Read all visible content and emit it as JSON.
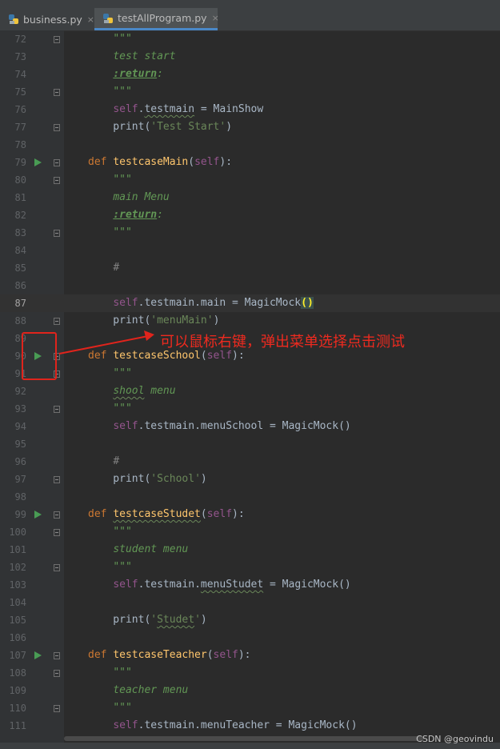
{
  "tabs": [
    {
      "label": "business.py",
      "active": false
    },
    {
      "label": "testAllProgram.py",
      "active": true
    }
  ],
  "tab_close_glyph": "×",
  "lines": [
    {
      "n": "72",
      "html": "    <span class='doc'>\"\"\"</span>"
    },
    {
      "n": "73",
      "html": "    <span class='doc'>test start</span>"
    },
    {
      "n": "74",
      "html": "    <span class='doctag'>:return</span><span class='doc'>:</span>"
    },
    {
      "n": "75",
      "html": "    <span class='doc'>\"\"\"</span>"
    },
    {
      "n": "76",
      "html": "    <span class='self'>self</span>.<span class='wavy'>testmain</span> = MainShow"
    },
    {
      "n": "77",
      "html": "    print(<span class='str'>'Test Start'</span>)"
    },
    {
      "n": "78",
      "html": ""
    },
    {
      "n": "79",
      "html": "<span class='kw'>def </span><span class='fn'>testcaseMain</span>(<span class='self'>self</span>):"
    },
    {
      "n": "80",
      "html": "    <span class='doc'>\"\"\"</span>"
    },
    {
      "n": "81",
      "html": "    <span class='doc'>main Menu</span>"
    },
    {
      "n": "82",
      "html": "    <span class='doctag'>:return</span><span class='doc'>:</span>"
    },
    {
      "n": "83",
      "html": "    <span class='doc'>\"\"\"</span>"
    },
    {
      "n": "84",
      "html": ""
    },
    {
      "n": "85",
      "html": "    <span class='cmt'>#</span>"
    },
    {
      "n": "86",
      "html": ""
    },
    {
      "n": "87",
      "html": "    <span class='self'>self</span>.testmain.main = MagicMock<span class='paren-hl'>()</span>"
    },
    {
      "n": "88",
      "html": "    print(<span class='str'>'menuMain'</span>)"
    },
    {
      "n": "89",
      "html": ""
    },
    {
      "n": "90",
      "html": "<span class='kw'>def </span><span class='fn'>testcaseSchool</span>(<span class='self'>self</span>):"
    },
    {
      "n": "91",
      "html": "    <span class='doc'>\"\"\"</span>"
    },
    {
      "n": "92",
      "html": "    <span class='doc wavy'>shool</span><span class='doc'> menu</span>"
    },
    {
      "n": "93",
      "html": "    <span class='doc'>\"\"\"</span>"
    },
    {
      "n": "94",
      "html": "    <span class='self'>self</span>.testmain.menuSchool = MagicMock()"
    },
    {
      "n": "95",
      "html": ""
    },
    {
      "n": "96",
      "html": "    <span class='cmt'>#</span>"
    },
    {
      "n": "97",
      "html": "    print(<span class='str'>'School'</span>)"
    },
    {
      "n": "98",
      "html": ""
    },
    {
      "n": "99",
      "html": "<span class='kw'>def </span><span class='fn wavy'>testcaseStudet</span>(<span class='self'>self</span>):"
    },
    {
      "n": "100",
      "html": "    <span class='doc'>\"\"\"</span>"
    },
    {
      "n": "101",
      "html": "    <span class='doc'>student menu</span>"
    },
    {
      "n": "102",
      "html": "    <span class='doc'>\"\"\"</span>"
    },
    {
      "n": "103",
      "html": "    <span class='self'>self</span>.testmain.<span class='wavy'>menuStudet</span> = MagicMock()"
    },
    {
      "n": "104",
      "html": ""
    },
    {
      "n": "105",
      "html": "    print(<span class='str'>'<span class=\"wavy\">Studet</span>'</span>)"
    },
    {
      "n": "106",
      "html": ""
    },
    {
      "n": "107",
      "html": "<span class='kw'>def </span><span class='fn'>testcaseTeacher</span>(<span class='self'>self</span>):"
    },
    {
      "n": "108",
      "html": "    <span class='doc'>\"\"\"</span>"
    },
    {
      "n": "109",
      "html": "    <span class='doc'>teacher menu</span>"
    },
    {
      "n": "110",
      "html": "    <span class='doc'>\"\"\"</span>"
    },
    {
      "n": "111",
      "html": "    <span class='self'>self</span>.testmain.menuTeacher = MagicMock()"
    }
  ],
  "current_line": "87",
  "run_lines": [
    "79",
    "90",
    "99",
    "107"
  ],
  "fold_lines": [
    "72",
    "75",
    "77",
    "79",
    "80",
    "83",
    "88",
    "90",
    "91",
    "93",
    "97",
    "99",
    "100",
    "102",
    "107",
    "108",
    "110"
  ],
  "annotation_text": "可以鼠标右键，弹出菜单选择点击测试",
  "watermark": "CSDN @geovindu",
  "colors": {
    "annotation": "#ee2a1f",
    "run_icon": "#499c54",
    "keyword": "#cc7832",
    "function": "#ffc66d",
    "string": "#6a8759",
    "self": "#94558d"
  }
}
